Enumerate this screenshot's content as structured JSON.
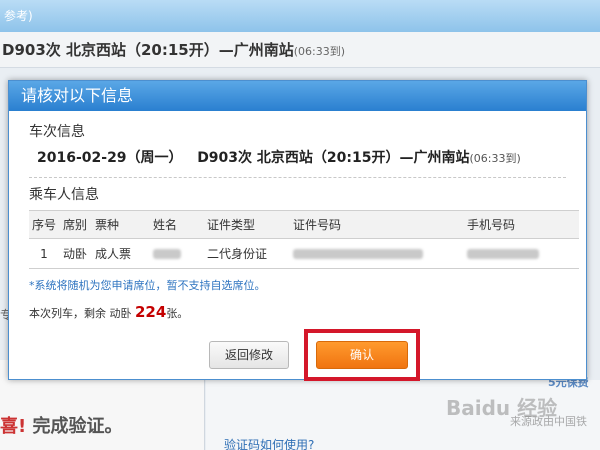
{
  "background": {
    "topbar_text": "参考)",
    "train_line": {
      "main": "D903次 北京西站（20:15开）—广州南站",
      "arrive": "(06:33到)"
    },
    "bottom_red": "喜!",
    "bottom_grey": "完成验证。",
    "help_link": "验证码如何使用?",
    "side_char": "专",
    "edge_text": "5元保费",
    "watermark": "Baidu 经验",
    "watermark_sub": "来源政由中国铁"
  },
  "dialog": {
    "title": "请核对以下信息",
    "train_section_title": "车次信息",
    "train_info": {
      "date": "2016-02-29（周一）",
      "train": "D903次 北京西站（20:15开）—广州南站",
      "arrive": "(06:33到)"
    },
    "passenger_section_title": "乘车人信息",
    "table": {
      "headers": [
        "序号",
        "席别",
        "票种",
        "姓名",
        "证件类型",
        "证件号码",
        "手机号码"
      ],
      "rows": [
        {
          "num": "1",
          "seat": "动卧",
          "ticket_type": "成人票",
          "id_type": "二代身份证"
        }
      ]
    },
    "note": "*系统将随机为您申请席位，暂不支持自选席位。",
    "remain": {
      "prefix": "本次列车，剩余 动卧",
      "count": "224",
      "suffix": "张。"
    },
    "buttons": {
      "back": "返回修改",
      "confirm": "确认"
    }
  }
}
